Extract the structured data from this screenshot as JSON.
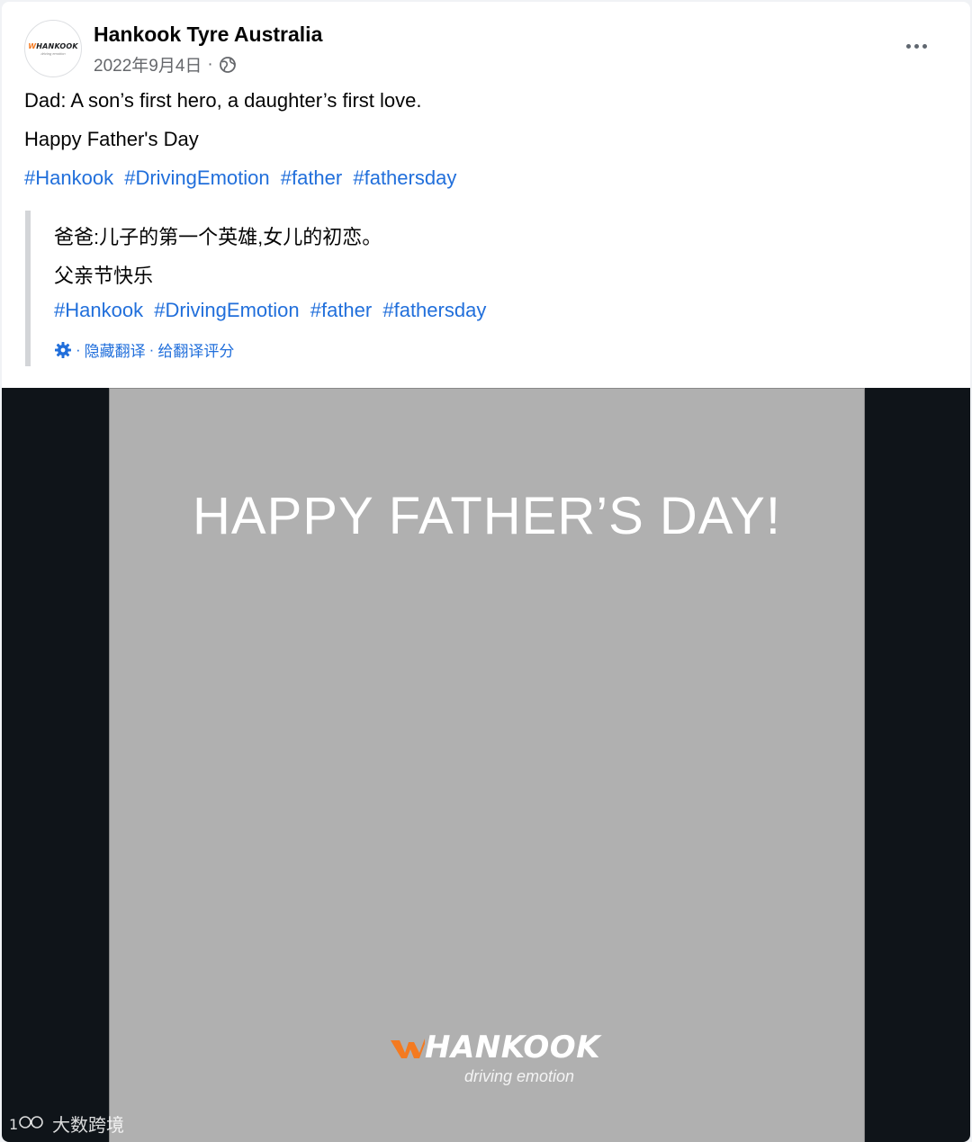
{
  "page": {
    "name": "Hankook Tyre Australia",
    "avatar_text": "HANKOOK",
    "avatar_subtext": "driving emotion",
    "date": "2022年9月4日",
    "meta_sep": "·"
  },
  "post": {
    "line1": "Dad: A son’s first hero, a daughter’s first love.",
    "line2": "Happy Father's Day",
    "hashtags": [
      "#Hankook",
      "#DrivingEmotion",
      "#father",
      "#fathersday"
    ]
  },
  "translation": {
    "line1": "爸爸:儿子的第一个英雄,女儿的初恋。",
    "line2": "父亲节快乐",
    "hashtags": [
      "#Hankook",
      "#DrivingEmotion",
      "#father",
      "#fathersday"
    ],
    "sep": "·",
    "hide_label": "隐藏翻译",
    "rate_label": "给翻译评分"
  },
  "image": {
    "headline": "HAPPY FATHER’S DAY!",
    "brand": "HANKOOK",
    "tagline": "driving emotion"
  },
  "watermark": {
    "text": "大数跨境"
  },
  "colors": {
    "link": "#216fdb",
    "brand_orange": "#f47a20",
    "text": "#050505",
    "meta": "#65676b"
  }
}
